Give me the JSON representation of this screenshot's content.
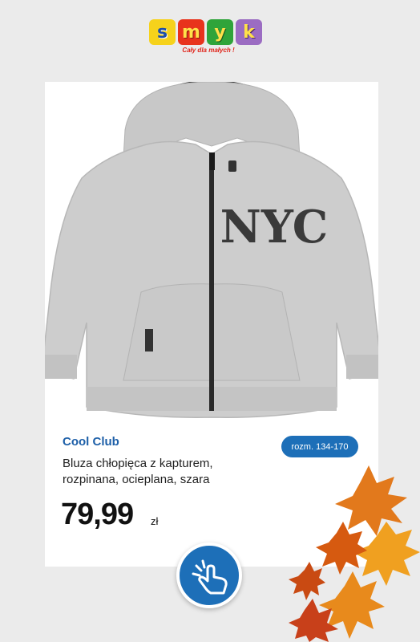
{
  "logo": {
    "letters": [
      "s",
      "m",
      "y",
      "k"
    ],
    "letter_colors": [
      "#f6d21b",
      "#e8331c",
      "#2fa43a",
      "#9b6cc2"
    ],
    "tagline": "Cały dla małych !"
  },
  "product": {
    "image_icon": "hoodie-image",
    "print_text": "NYC",
    "brand": "Cool Club",
    "size_label": "rozm. 134-170",
    "description_line1": "Bluza chłopięca z kapturem,",
    "description_line2": "rozpinana, ocieplana, szara",
    "price": "79,99",
    "currency": "zł"
  },
  "cta": {
    "icon": "tap-hand-icon"
  },
  "decoration": {
    "icon": "autumn-leaves-icon"
  },
  "colors": {
    "background": "#ebebeb",
    "card": "#ffffff",
    "accent_blue": "#1d6fb8",
    "brand_blue": "#1d5fa8"
  }
}
